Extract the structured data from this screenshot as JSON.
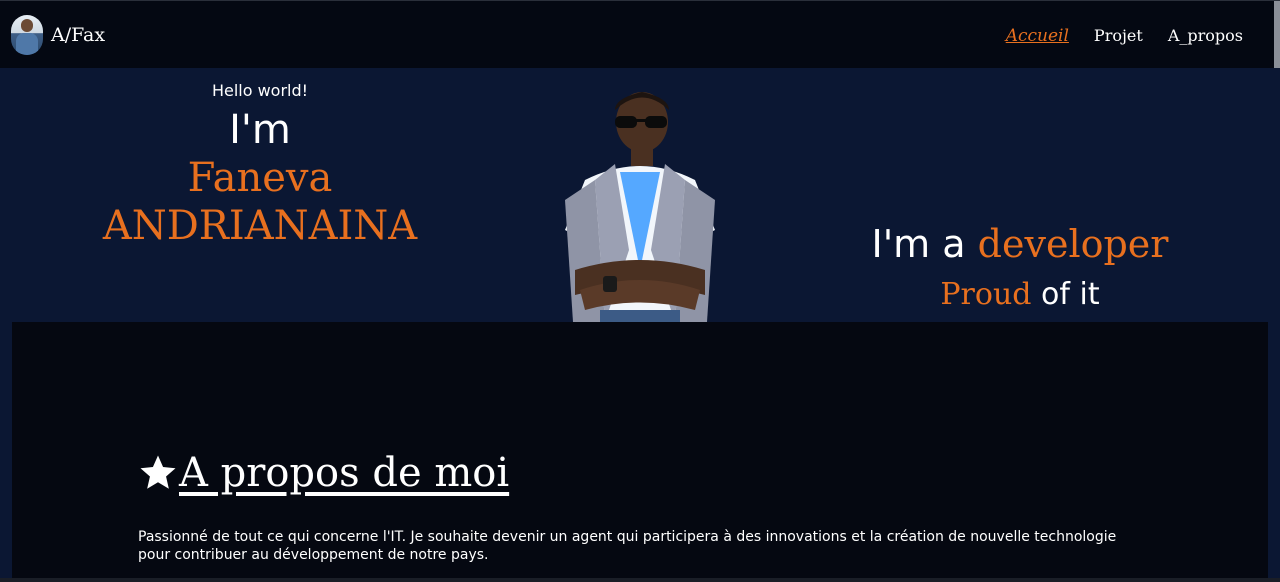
{
  "navbar": {
    "brand": "A/Fax",
    "links": [
      {
        "label": "Accueil",
        "active": true
      },
      {
        "label": "Projet",
        "active": false
      },
      {
        "label": "A_propos",
        "active": false
      }
    ]
  },
  "hero": {
    "greeting": "Hello world!",
    "intro": "I'm",
    "first_name": "Faneva",
    "last_name": "ANDRIANAINA",
    "role_prefix": "I'm a",
    "role": "developer",
    "proud_word": "Proud",
    "proud_suffix": "of it"
  },
  "about": {
    "icon": "star-icon",
    "heading": "A propos de moi",
    "paragraph": "Passionné de tout ce qui concerne l'IT. Je souhaite devenir un agent qui participera à des innovations et la création de nouvelle technologie pour contribuer au développement de notre pays."
  },
  "colors": {
    "accent": "#e8701f",
    "hero_bg": "#0b1733",
    "navbar_bg": "#040812",
    "about_bg": "#050811"
  }
}
